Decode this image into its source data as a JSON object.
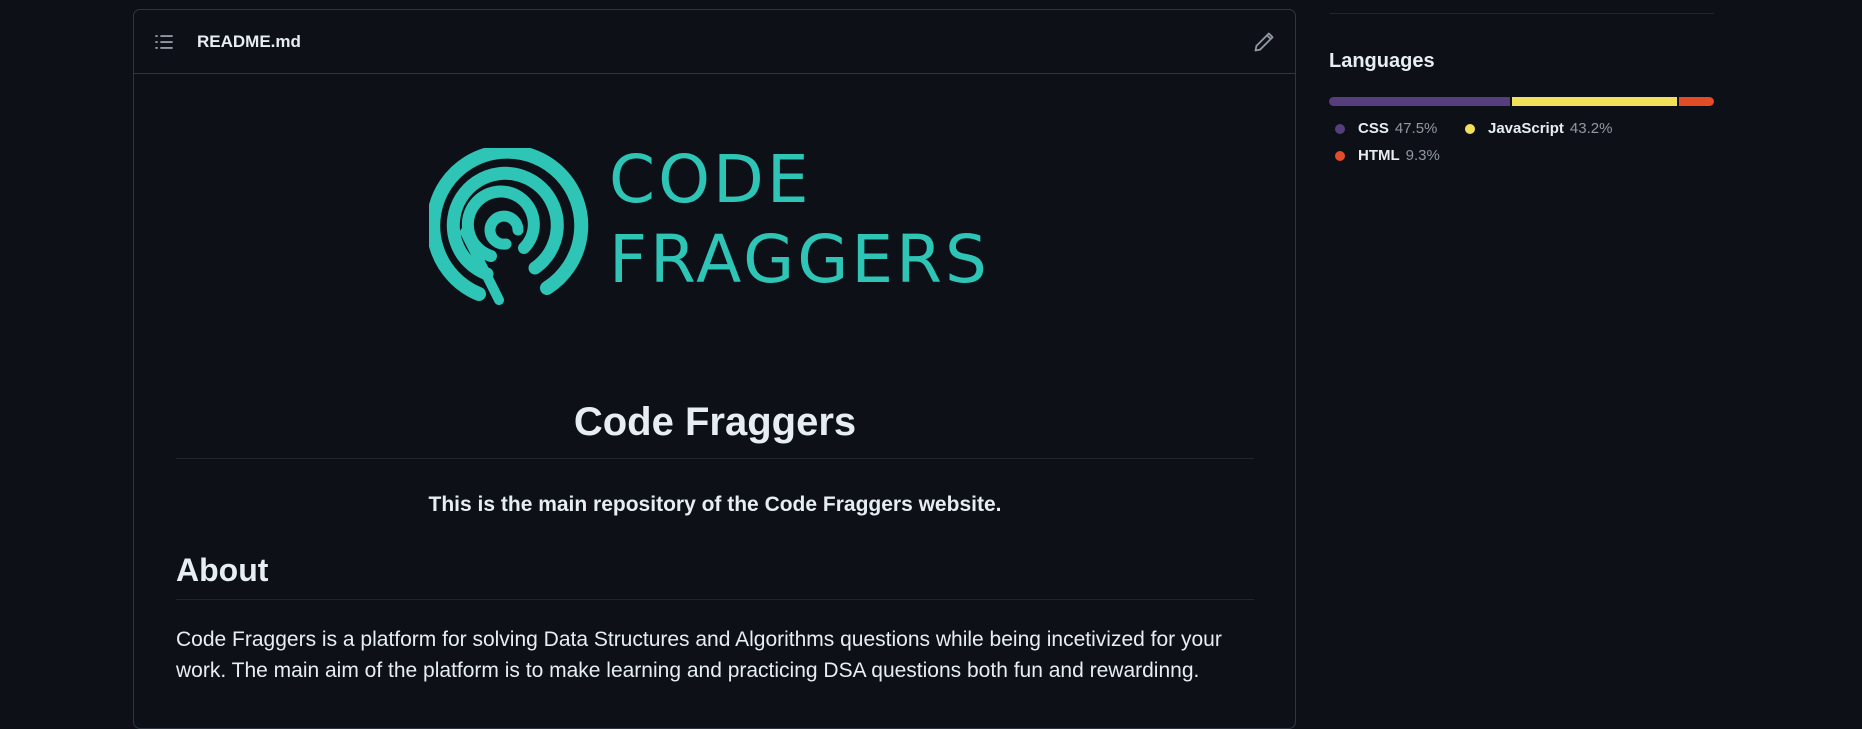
{
  "readme": {
    "filename": "README.md",
    "logo": {
      "line1": "CODE",
      "line2": "FRAGGERS",
      "color": "#2ec4b6"
    },
    "title": "Code Fraggers",
    "tagline": "This is the main repository of the Code Fraggers website.",
    "about_heading": "About",
    "about_text": "Code Fraggers is a platform for solving Data Structures and Algorithms questions while being incetivized for your work. The main aim of the platform is to make learning and practicing DSA questions both fun and rewardinng."
  },
  "languages": {
    "heading": "Languages",
    "items": [
      {
        "name": "CSS",
        "percent": "47.5%",
        "value": 47.5,
        "color": "#563d7c"
      },
      {
        "name": "JavaScript",
        "percent": "43.2%",
        "value": 43.2,
        "color": "#f1e05a"
      },
      {
        "name": "HTML",
        "percent": "9.3%",
        "value": 9.3,
        "color": "#e34c26"
      }
    ]
  },
  "icons": {
    "toc": "list-unordered-icon",
    "edit": "pencil-icon"
  }
}
